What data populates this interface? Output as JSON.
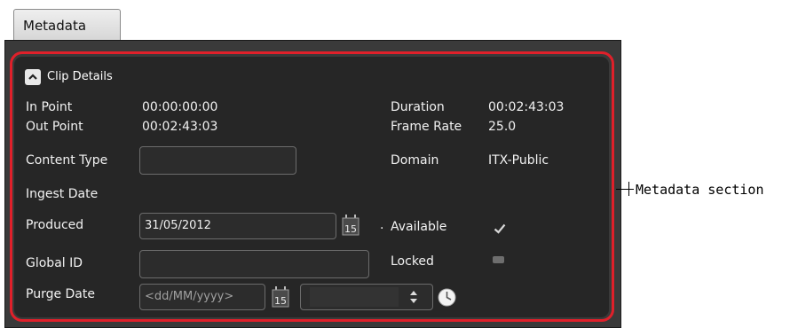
{
  "tab": {
    "label": "Metadata"
  },
  "section": {
    "title": "Clip Details"
  },
  "fields": {
    "in_point": {
      "label": "In Point",
      "value": "00:00:00:00"
    },
    "out_point": {
      "label": "Out Point",
      "value": "00:02:43:03"
    },
    "content_type": {
      "label": "Content Type",
      "value": ""
    },
    "ingest_date": {
      "label": "Ingest Date"
    },
    "produced": {
      "label": "Produced",
      "value": "31/05/2012"
    },
    "global_id": {
      "label": "Global ID",
      "value": ""
    },
    "purge_date": {
      "label": "Purge Date",
      "placeholder": "<dd/MM/yyyy>"
    },
    "duration": {
      "label": "Duration",
      "value": "00:02:43:03"
    },
    "frame_rate": {
      "label": "Frame Rate",
      "value": "25.0"
    },
    "domain": {
      "label": "Domain",
      "value": "ITX-Public"
    },
    "available": {
      "label": "Available",
      "checked": true
    },
    "locked": {
      "label": "Locked",
      "checked": false
    }
  },
  "calendar_icon": {
    "day": "15"
  },
  "callout": {
    "label": "Metadata section"
  },
  "colors": {
    "highlight": "#e0202a",
    "panel": "#262626",
    "text": "#f2f2f2"
  }
}
